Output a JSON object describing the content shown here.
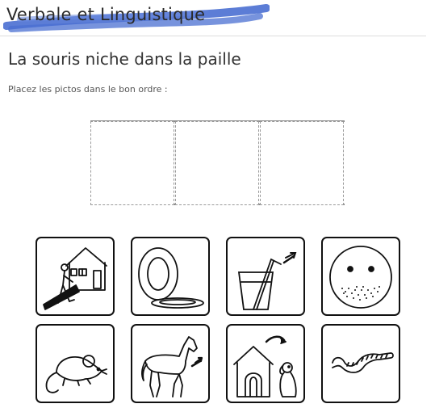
{
  "app": {
    "title": "Verbale et Linguistique",
    "brush_color": "#4a6fd1"
  },
  "exercise": {
    "title": "La souris niche dans la paille",
    "instruction": "Placez les pictos dans le bon ordre :"
  },
  "dropzones": [
    {
      "slot": 1,
      "value": ""
    },
    {
      "slot": 2,
      "value": ""
    },
    {
      "slot": 3,
      "value": ""
    }
  ],
  "pictos": [
    {
      "id": "house-person",
      "icon": "person-entering-house-icon"
    },
    {
      "id": "plate",
      "icon": "plate-icon"
    },
    {
      "id": "glass",
      "icon": "glass-with-straw-icon"
    },
    {
      "id": "face",
      "icon": "bearded-face-icon"
    },
    {
      "id": "mouse",
      "icon": "mouse-icon"
    },
    {
      "id": "horse",
      "icon": "horse-icon"
    },
    {
      "id": "doghouse",
      "icon": "dog-and-kennel-icon"
    },
    {
      "id": "worm",
      "icon": "worm-icon"
    }
  ]
}
